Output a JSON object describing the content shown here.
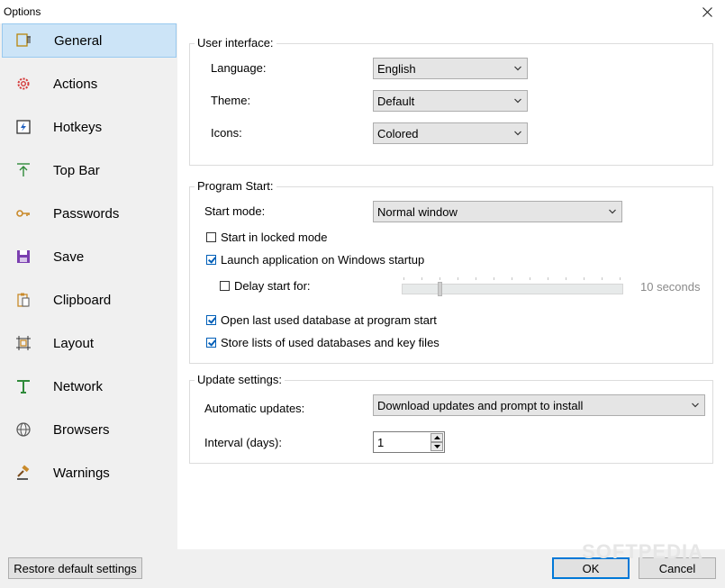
{
  "window": {
    "title": "Options"
  },
  "sidebar": {
    "items": [
      {
        "label": "General",
        "icon": "general-icon"
      },
      {
        "label": "Actions",
        "icon": "gear-icon"
      },
      {
        "label": "Hotkeys",
        "icon": "hotkeys-icon"
      },
      {
        "label": "Top Bar",
        "icon": "arrow-up-icon"
      },
      {
        "label": "Passwords",
        "icon": "key-icon"
      },
      {
        "label": "Save",
        "icon": "floppy-icon"
      },
      {
        "label": "Clipboard",
        "icon": "clipboard-icon"
      },
      {
        "label": "Layout",
        "icon": "layout-icon"
      },
      {
        "label": "Network",
        "icon": "network-icon"
      },
      {
        "label": "Browsers",
        "icon": "globe-icon"
      },
      {
        "label": "Warnings",
        "icon": "gavel-icon"
      }
    ]
  },
  "ui_group": {
    "title": "User interface:",
    "language_label": "Language:",
    "language_value": "English",
    "theme_label": "Theme:",
    "theme_value": "Default",
    "icons_label": "Icons:",
    "icons_value": "Colored"
  },
  "start_group": {
    "title": "Program Start:",
    "start_mode_label": "Start mode:",
    "start_mode_value": "Normal window",
    "locked_label": "Start in locked mode",
    "launch_label": "Launch application on Windows startup",
    "delay_label": "Delay start for:",
    "delay_value": "10 seconds",
    "open_last_label": "Open last used database at program start",
    "store_lists_label": "Store lists of used databases and key files"
  },
  "update_group": {
    "title": "Update settings:",
    "auto_label": "Automatic updates:",
    "auto_value": "Download updates and prompt to install",
    "interval_label": "Interval (days):",
    "interval_value": "1"
  },
  "footer": {
    "restore_label": "Restore default settings",
    "ok_label": "OK",
    "cancel_label": "Cancel"
  },
  "watermark": "SOFTPEDIA"
}
